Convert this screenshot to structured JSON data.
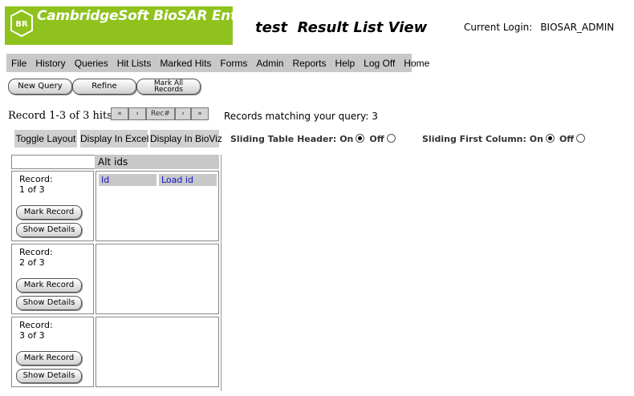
{
  "header": {
    "logo_text": "CambridgeSoft BioSAR Enterprise",
    "logo_badge": "BR",
    "page_title": "test  Result List View",
    "login_label": "Current Login:",
    "login_user": "BIOSAR_ADMIN"
  },
  "menu": [
    "File",
    "History",
    "Queries",
    "Hit Lists",
    "Marked Hits",
    "Forms",
    "Admin",
    "Reports",
    "Help",
    "Log Off",
    "Home"
  ],
  "actions": {
    "new_query": "New Query",
    "refine": "Refine",
    "mark_all_line1": "Mark All",
    "mark_all_line2": "Records"
  },
  "nav": {
    "record_range": "Record 1-3 of 3 hits",
    "first": "«",
    "prev": "‹",
    "rec": "Rec#",
    "next": "›",
    "last": "»",
    "matching": "Records matching your query: 3"
  },
  "toolbar": {
    "toggle_layout": "Toggle Layout",
    "display_excel": "Display In Excel",
    "display_bioviz": "Display In BioViz",
    "sliding_header_label": "Sliding Table Header:",
    "sliding_first_col_label": "Sliding First Column:",
    "on": "On",
    "off": "Off"
  },
  "grid": {
    "column_header": "Alt ids",
    "subheaders": [
      "Id",
      "Load id"
    ],
    "records": [
      {
        "label": "Record:",
        "position": "1 of 3",
        "mark": "Mark Record",
        "details": "Show Details"
      },
      {
        "label": "Record:",
        "position": "2 of 3",
        "mark": "Mark Record",
        "details": "Show Details"
      },
      {
        "label": "Record:",
        "position": "3 of 3",
        "mark": "Mark Record",
        "details": "Show Details"
      }
    ]
  },
  "colors": {
    "logo_green": "#8fc21c",
    "menu_gray": "#c8c8c8",
    "link_blue": "#1010c8"
  }
}
